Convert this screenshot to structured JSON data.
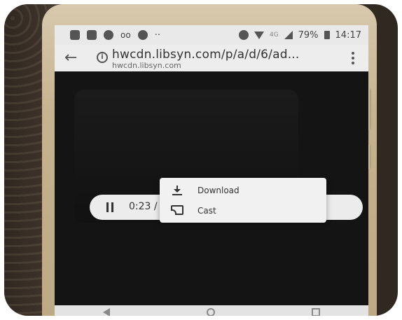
{
  "status_bar": {
    "signal_label": "4G",
    "battery": "79%",
    "time": "14:17"
  },
  "browser": {
    "url": "hwcdn.libsyn.com/p/a/d/6/ad...",
    "domain": "hwcdn.libsyn.com"
  },
  "player": {
    "time_display": "0:23 /"
  },
  "context_menu": {
    "items": [
      {
        "label": "Download",
        "icon": "download-icon"
      },
      {
        "label": "Cast",
        "icon": "cast-icon"
      }
    ]
  },
  "nav_bar": {
    "buttons": [
      "back",
      "home",
      "recents"
    ]
  },
  "colors": {
    "menu_background": "#f1f1f1",
    "controls_background": "#ececec",
    "screen_background": "#141414"
  }
}
